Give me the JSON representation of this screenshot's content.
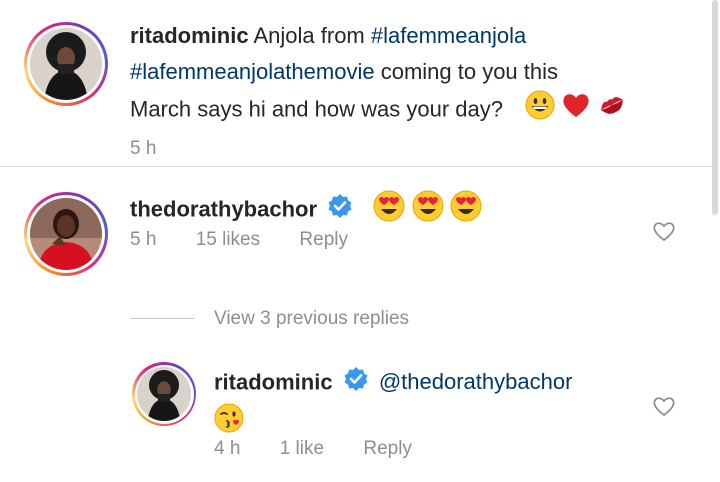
{
  "post": {
    "username": "ritadominic",
    "caption_text": "Anjola from",
    "hashtag1": "#lafemmeanjola",
    "hashtag2": "#lafemmeanjolathemovie",
    "caption_rest1": "coming to you this",
    "caption_rest2": "March says hi and how was your day?",
    "time": "5 h",
    "emojis": [
      "grinning-face",
      "red-heart",
      "kiss-mark"
    ]
  },
  "comment": {
    "username": "thedorathybachor",
    "verified": true,
    "emojis": [
      "heart-eyes",
      "heart-eyes",
      "heart-eyes"
    ],
    "time": "5 h",
    "likes": "15 likes",
    "reply": "Reply"
  },
  "view_replies": "View 3 previous replies",
  "reply": {
    "username": "ritadominic",
    "verified": true,
    "mention": "@thedorathybachor",
    "emojis": [
      "face-blowing-kiss"
    ],
    "time": "4 h",
    "likes": "1 like",
    "reply": "Reply"
  },
  "colors": {
    "verified": "#3897f0",
    "hashtag": "#00376b",
    "meta": "#8e8e8e",
    "divider": "#dbdbdb"
  }
}
